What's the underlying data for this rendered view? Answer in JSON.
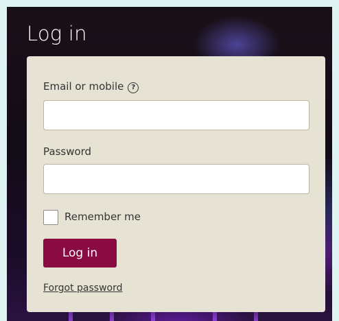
{
  "page": {
    "title": "Log in"
  },
  "form": {
    "email": {
      "label": "Email or mobile",
      "help_icon": "question-circle-icon",
      "value": "",
      "placeholder": ""
    },
    "password": {
      "label": "Password",
      "value": "",
      "placeholder": ""
    },
    "remember": {
      "label": "Remember me",
      "checked": false
    },
    "submit_label": "Log in",
    "forgot_label": "Forgot password"
  },
  "colors": {
    "card_bg": "#e6e3d4",
    "button_bg": "#8a0a42",
    "page_bg": "#dff3f3"
  }
}
